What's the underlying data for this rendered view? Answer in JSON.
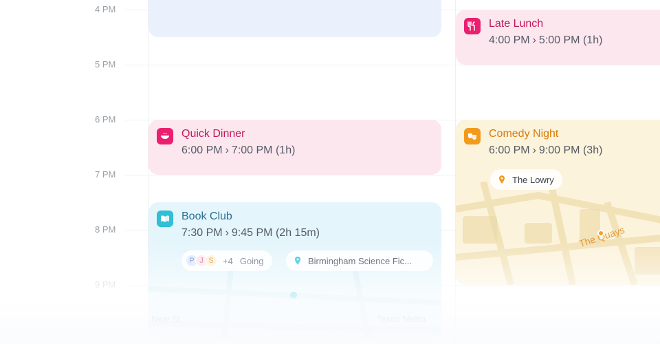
{
  "time_labels": [
    "4 PM",
    "5 PM",
    "6 PM",
    "7 PM",
    "8 PM",
    "9 PM"
  ],
  "events": {
    "late_lunch": {
      "title": "Late Lunch",
      "start": "4:00 PM",
      "end": "5:00 PM",
      "duration": "(1h)",
      "icon": "utensils-icon",
      "color": "#ea1f6f"
    },
    "quick_dinner": {
      "title": "Quick Dinner",
      "start": "6:00 PM",
      "end": "7:00 PM",
      "duration": "(1h)",
      "icon": "bowl-icon",
      "color": "#ea1f6f"
    },
    "comedy_night": {
      "title": "Comedy Night",
      "start": "6:00 PM",
      "end": "9:00 PM",
      "duration": "(3h)",
      "icon": "theater-masks-icon",
      "color": "#f29a1c",
      "location": "The Lowry",
      "map_label": "The Quays"
    },
    "book_club": {
      "title": "Book Club",
      "start": "7:30 PM",
      "end": "9:45 PM",
      "duration": "(2h 15m)",
      "icon": "book-icon",
      "color": "#2fbfd6",
      "attendees": [
        "P",
        "J",
        "S"
      ],
      "more_attendees": "+4",
      "going_label": "Going",
      "location": "Birmingham Science Fic...",
      "map_streets": [
        "New St",
        "Tesco Metro"
      ]
    }
  },
  "time_separator_icon": "chevron-right-icon"
}
